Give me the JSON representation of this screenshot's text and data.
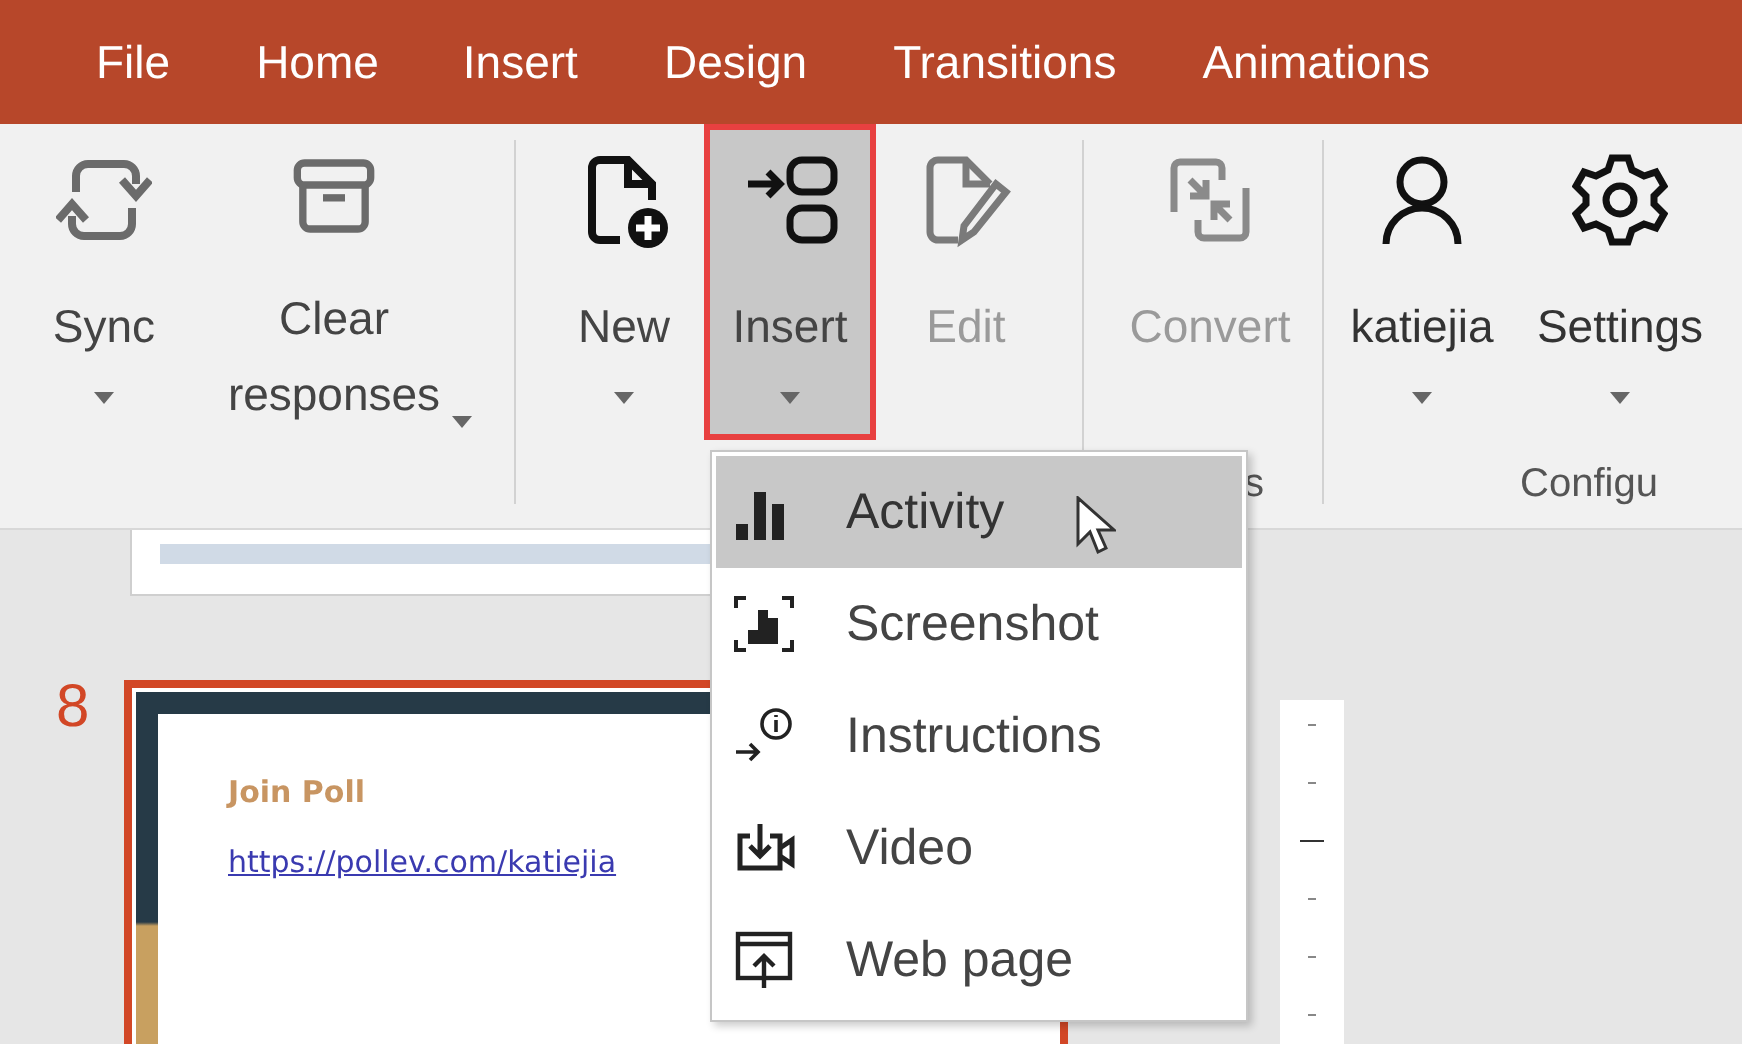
{
  "tabs": [
    {
      "label": "File"
    },
    {
      "label": "Home"
    },
    {
      "label": "Insert"
    },
    {
      "label": "Design"
    },
    {
      "label": "Transitions"
    },
    {
      "label": "Animations"
    }
  ],
  "ribbon_groups": [
    {
      "buttons": [
        {
          "kind": "sync",
          "label": "Sync",
          "disabled": false,
          "selected": false
        },
        {
          "kind": "clear",
          "label": "Clear responses",
          "disabled": false,
          "selected": false
        }
      ]
    },
    {
      "buttons": [
        {
          "kind": "new",
          "label": "New",
          "disabled": false,
          "selected": false
        },
        {
          "kind": "insert",
          "label": "Insert",
          "disabled": false,
          "selected": true
        },
        {
          "kind": "edit",
          "label": "Edit",
          "disabled": true,
          "selected": false
        }
      ]
    },
    {
      "label": "s",
      "buttons": [
        {
          "kind": "convert",
          "label": "Convert",
          "disabled": true,
          "selected": false
        }
      ]
    },
    {
      "label": "Configu",
      "buttons": [
        {
          "kind": "account",
          "label": "katiejia",
          "disabled": false,
          "selected": false
        },
        {
          "kind": "settings",
          "label": "Settings",
          "disabled": false,
          "selected": false
        }
      ]
    }
  ],
  "menu": [
    {
      "kind": "activity",
      "label": "Activity",
      "selected": true
    },
    {
      "kind": "screenshot",
      "label": "Screenshot",
      "selected": false
    },
    {
      "kind": "instructions",
      "label": "Instructions",
      "selected": false
    },
    {
      "kind": "video",
      "label": "Video",
      "selected": false
    },
    {
      "kind": "webpage",
      "label": "Web page",
      "selected": false
    }
  ],
  "slide": {
    "number": "8",
    "title": "Join Poll",
    "link": "https://pollev.com/katiejia"
  }
}
